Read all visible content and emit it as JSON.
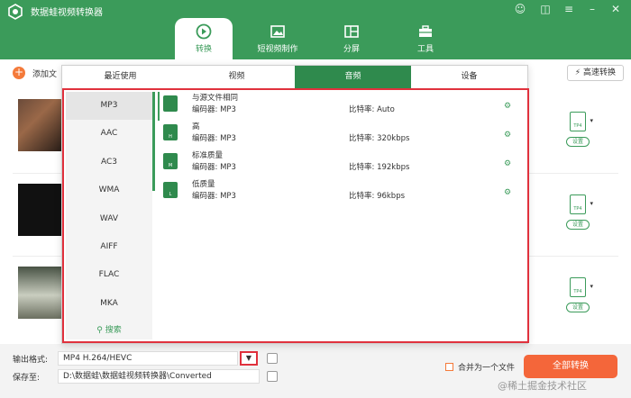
{
  "window": {
    "title": "数据蛙视频转换器",
    "controls": [
      "user-icon",
      "gift-icon",
      "settings-icon",
      "minimize-icon",
      "close-icon"
    ]
  },
  "nav_tabs": [
    {
      "label": "转换",
      "icon": "convert-icon",
      "active": true
    },
    {
      "label": "短视频制作",
      "icon": "video-maker-icon",
      "active": false
    },
    {
      "label": "分屏",
      "icon": "split-screen-icon",
      "active": false
    },
    {
      "label": "工具",
      "icon": "toolbox-icon",
      "active": false
    }
  ],
  "toolbar": {
    "add_file_label": "添加文",
    "fast_convert_label": "高速转换"
  },
  "file_rows": [
    {
      "thumb": "landscape-video-thumbnail",
      "format_badge": "TP4",
      "settings_label": "设置"
    },
    {
      "thumb": "dark-video-thumbnail",
      "format_badge": "TP4",
      "settings_label": "设置"
    },
    {
      "thumb": "flower-video-thumbnail",
      "format_badge": "TP4",
      "settings_label": "设置"
    }
  ],
  "popup": {
    "tabs": [
      {
        "label": "最近使用",
        "active": false
      },
      {
        "label": "视频",
        "active": false
      },
      {
        "label": "音频",
        "active": true
      },
      {
        "label": "设备",
        "active": false
      }
    ],
    "formats": [
      "MP3",
      "AAC",
      "AC3",
      "WMA",
      "WAV",
      "AIFF",
      "FLAC",
      "MKA"
    ],
    "selected_format": "MP3",
    "search_label": "搜索",
    "options": [
      {
        "name": "与源文件相同",
        "encoder": "编码器:   MP3",
        "bitrate": "比特率:   Auto",
        "badge": ""
      },
      {
        "name": "高",
        "encoder": "编码器:   MP3",
        "bitrate": "比特率:   320kbps",
        "badge": "H"
      },
      {
        "name": "标准质量",
        "encoder": "编码器:   MP3",
        "bitrate": "比特率:   192kbps",
        "badge": "M"
      },
      {
        "name": "低质量",
        "encoder": "编码器:   MP3",
        "bitrate": "比特率:   96kbps",
        "badge": "L"
      }
    ]
  },
  "bottom": {
    "output_format_label": "输出格式:",
    "output_format_value": "MP4 H.264/HEVC",
    "save_to_label": "保存至:",
    "save_to_value": "D:\\数据蛙\\数据蛙视频转换器\\Converted",
    "merge_label": "合并为一个文件",
    "convert_all_label": "全部转换"
  },
  "watermark": "@稀土掘金技术社区",
  "colors": {
    "brand_green": "#3b9b5a",
    "active_tab_green": "#2f8a4d",
    "accent_orange": "#f4663a",
    "highlight_red": "#e0313d"
  }
}
